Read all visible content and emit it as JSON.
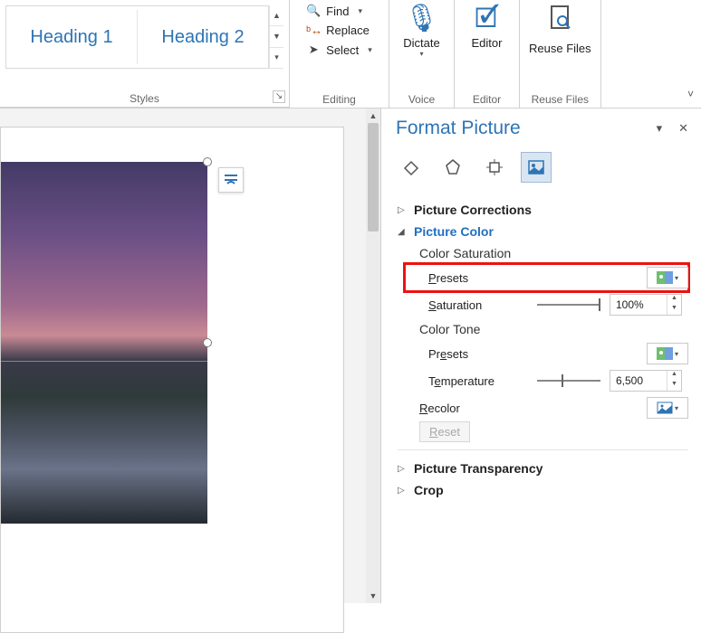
{
  "ribbon": {
    "styles": {
      "heading1": "Heading 1",
      "heading2": "Heading 2",
      "group_label": "Styles"
    },
    "editing": {
      "find": "Find",
      "replace": "Replace",
      "select": "Select",
      "group_label": "Editing"
    },
    "dictate": {
      "label": "Dictate",
      "group_label": "Voice"
    },
    "editor": {
      "label": "Editor",
      "group_label": "Editor"
    },
    "reuse": {
      "label": "Reuse Files",
      "group_label": "Reuse Files"
    }
  },
  "pane": {
    "title": "Format Picture",
    "sections": {
      "corrections": "Picture Corrections",
      "color": "Picture Color",
      "transparency": "Picture Transparency",
      "crop": "Crop"
    },
    "color": {
      "saturation_header": "Color Saturation",
      "presets": "Presets",
      "saturation": "Saturation",
      "saturation_value": "100%",
      "tone_header": "Color Tone",
      "tone_presets": "Presets",
      "temperature": "Temperature",
      "temperature_value": "6,500",
      "recolor": "Recolor",
      "reset": "Reset"
    },
    "icons": {
      "fill": "fill-line-icon",
      "effects": "effects-icon",
      "layout": "layout-props-icon",
      "picture": "picture-icon"
    }
  }
}
